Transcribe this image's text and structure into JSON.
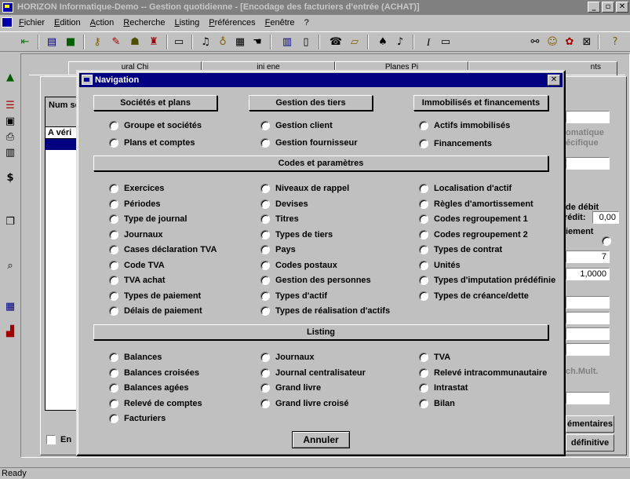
{
  "window": {
    "title": "HORIZON Informatique-Demo -- Gestion quotidienne - [Encodage des facturiers d'entrée (ACHAT)]",
    "buttons": [
      "_",
      "▫",
      "✕"
    ]
  },
  "menubar": {
    "items": [
      "Fichier",
      "Edition",
      "Action",
      "Recherche",
      "Listing",
      "Préférences",
      "Fenêtre",
      "?"
    ]
  },
  "background": {
    "grid_header": "Num séq.",
    "grid_row1": "A véri",
    "right_texts": {
      "informatique": "omatique",
      "specifique": "écifique",
      "debit_label": "de débit",
      "credit_label": "rédit:",
      "credit_value": "0,00",
      "paiement_label": "iement",
      "field_7": "7",
      "rate_value": "1,0000",
      "mult_label": "ch.Mult.",
      "complementaires_button": "émentaires",
      "definitive_button": "définitive"
    },
    "checkbox_label": "En",
    "tabs": [
      "ural Chi",
      "ini ene",
      "Planes Pi",
      "nts"
    ]
  },
  "status": {
    "text": "Ready"
  },
  "dialog": {
    "title": "Navigation",
    "sections": {
      "societes": {
        "title": "Sociétés et plans",
        "items": [
          "Groupe et sociétés",
          "Plans et comptes"
        ]
      },
      "tiers": {
        "title": "Gestion des tiers",
        "items": [
          "Gestion client",
          "Gestion fournisseur"
        ]
      },
      "immobilises": {
        "title": "Immobilisés et financements",
        "items": [
          "Actifs immobilisés",
          "Financements"
        ]
      },
      "codes": {
        "title": "Codes et paramètres",
        "col1": [
          "Exercices",
          "Périodes",
          "Type de journal",
          "Journaux",
          "Cases déclaration TVA",
          "Code TVA",
          "TVA achat",
          "Types de paiement",
          "Délais de paiement"
        ],
        "col2": [
          "Niveaux de rappel",
          "Devises",
          "Titres",
          "Types de tiers",
          "Pays",
          "Codes postaux",
          "Gestion des personnes",
          "Types d'actif",
          "Types de réalisation d'actifs"
        ],
        "col3": [
          "Localisation d'actif",
          "Règles d'amortissement",
          "Codes regroupement 1",
          "Codes regroupement 2",
          "Types de contrat",
          "Unités",
          "Types d'imputation prédéfinie",
          "Types de créance/dette"
        ]
      },
      "listing": {
        "title": "Listing",
        "col1": [
          "Balances",
          "Balances croisées",
          "Balances agées",
          "Relevé de comptes",
          "Facturiers"
        ],
        "col2": [
          "Journaux",
          "Journal centralisateur",
          "Grand livre",
          "Grand livre croisé"
        ],
        "col3": [
          "TVA",
          "Relevé intracommunautaire",
          "Intrastat",
          "Bilan"
        ]
      }
    },
    "cancel_label": "Annuler",
    "close_glyph": "✕"
  }
}
